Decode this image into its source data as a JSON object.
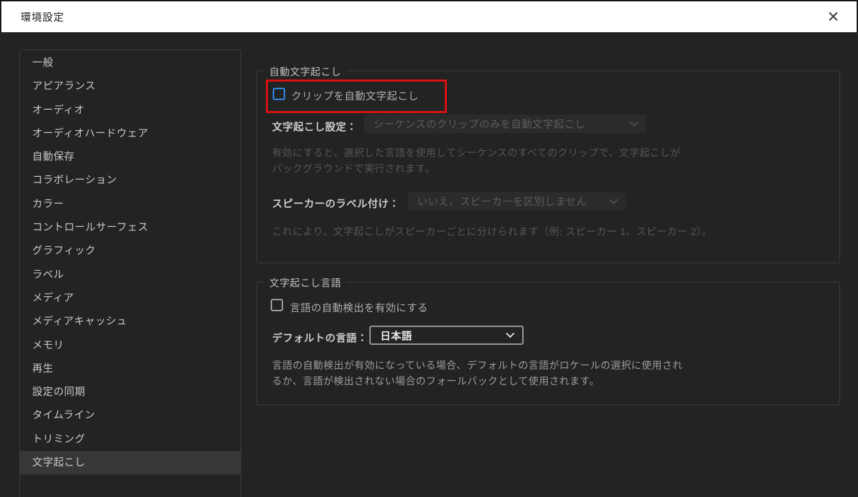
{
  "window": {
    "title": "環境設定",
    "close_icon": "✕"
  },
  "sidebar": {
    "items": [
      "一般",
      "アピアランス",
      "オーディオ",
      "オーディオハードウェア",
      "自動保存",
      "コラボレーション",
      "カラー",
      "コントロールサーフェス",
      "グラフィック",
      "ラベル",
      "メディア",
      "メディアキャッシュ",
      "メモリ",
      "再生",
      "設定の同期",
      "タイムライン",
      "トリミング",
      "文字起こし"
    ],
    "selected_index": 17
  },
  "auto_transcription": {
    "legend": "自動文字起こし",
    "clip_checkbox_label": "クリップを自動文字起こし",
    "clip_checkbox_checked": false,
    "setting_label": "文字起こし設定：",
    "setting_value": "シーケンスのクリップのみを自動文字起こし",
    "setting_desc_line1": "有効にすると、選択した言語を使用してシーケンスのすべてのクリップで、文字起こしが",
    "setting_desc_line2": "バックグラウンドで実行されます。",
    "speaker_label": "スピーカーのラベル付け：",
    "speaker_value": "いいえ、スピーカーを区別しません",
    "speaker_desc": "これにより、文字起こしがスピーカーごとに分けられます（例: スピーカー 1、スピーカー 2）。"
  },
  "transcription_language": {
    "legend": "文字起こし言語",
    "auto_detect_checkbox_label": "言語の自動検出を有効にする",
    "auto_detect_checkbox_checked": false,
    "default_language_label": "デフォルトの言語：",
    "default_language_value": "日本語",
    "desc_line1": "言語の自動検出が有効になっている場合、デフォルトの言語がロケールの選択に使用され",
    "desc_line2": "るか、言語が検出されない場合のフォールバックとして使用されます。"
  },
  "colors": {
    "window-bg": "#232323",
    "titlebar-bg": "#ffffff",
    "title-text": "#1c1c1c",
    "border": "#3c3c3c",
    "sidebar-text": "#c9c9c9",
    "selected-bg": "#373737",
    "accent-blue": "#2f8ceb",
    "annotation-red": "#dd1111",
    "disabled-select-bg": "#2b2b2b",
    "disabled-text": "#5c5c5c",
    "muted-desc": "#565656",
    "desc-text": "#9c9c9c",
    "label-text": "#cccccc",
    "checkbox-label": "#aeaeae",
    "select-border": "#9a9a9a",
    "select-text": "#eaeaea"
  }
}
